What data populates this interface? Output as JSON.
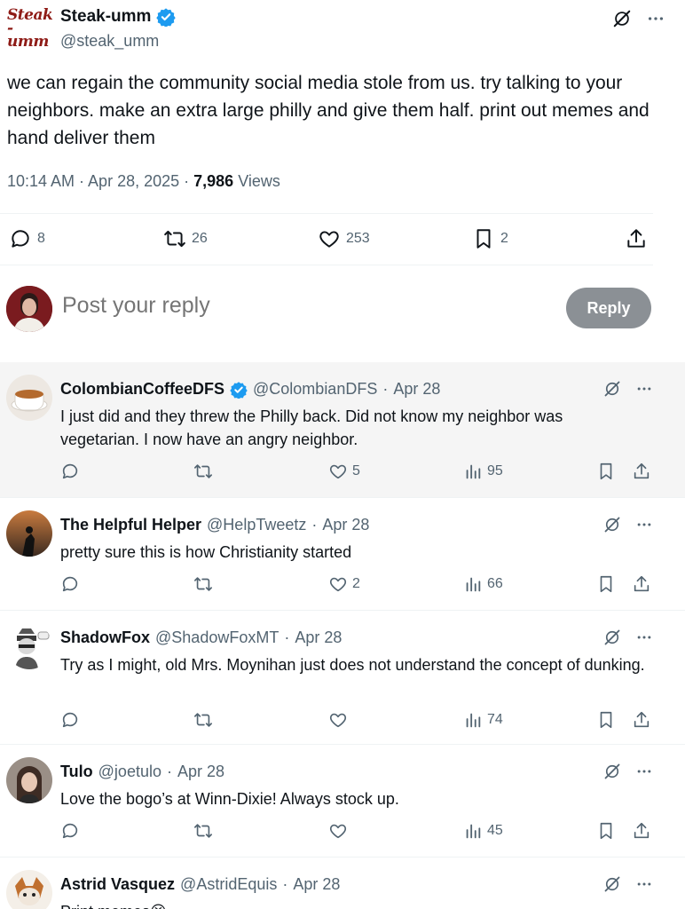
{
  "tweet": {
    "author_name": "Steak-umm",
    "author_handle": "@steak_umm",
    "logo_line1": "Steak",
    "logo_line2": "-umm",
    "text": "we can regain the community social media stole from us. try talking to your neighbors. make an extra large philly and give them half. print out memes and hand deliver them",
    "time": "10:14 AM · Apr 28, 2025 · ",
    "views_count": "7,986",
    "views_label": "Views",
    "replies": "8",
    "reposts": "26",
    "likes": "253",
    "bookmarks": "2"
  },
  "composer": {
    "placeholder": "Post your reply",
    "button": "Reply"
  },
  "replies": [
    {
      "name": "ColombianCoffeeDFS",
      "verified": true,
      "handle": "@ColombianDFS",
      "dot": "·",
      "date": "Apr 28",
      "text": "I just did and they threw the Philly back. Did not know my neighbor was vegetarian. I now have an angry neighbor.",
      "likes": "5",
      "views": "95"
    },
    {
      "name": "The Helpful Helper",
      "handle": "@HelpTweetz",
      "dot": "·",
      "date": "Apr 28",
      "text": "pretty sure this is how Christianity started",
      "likes": "2",
      "views": "66"
    },
    {
      "name": "ShadowFox",
      "handle": "@ShadowFoxMT",
      "dot": "·",
      "date": "Apr 28",
      "text": "Try as I might, old Mrs. Moynihan just does not understand the concept of dunking.",
      "likes": "",
      "views": "74"
    },
    {
      "name": "Tulo",
      "handle": "@joetulo",
      "dot": "·",
      "date": "Apr 28",
      "text": "Love the bogo’s at Winn-Dixie! Always stock up.",
      "likes": "",
      "views": "45"
    },
    {
      "name": "Astrid Vasquez",
      "handle": "@AstridEquis",
      "dot": "·",
      "date": "Apr 28",
      "text": "Print memes😆",
      "likes": "",
      "views": ""
    }
  ],
  "colors": {
    "verified": "#1d9bf0",
    "muted": "#536471",
    "shaded_row": "#f5f5f5",
    "reply_button": "#8b9095"
  },
  "icons": [
    "reply-icon",
    "repost-icon",
    "like-icon",
    "bookmark-icon",
    "share-icon",
    "views-icon",
    "grok-icon",
    "more-icon",
    "verified-badge-icon"
  ]
}
